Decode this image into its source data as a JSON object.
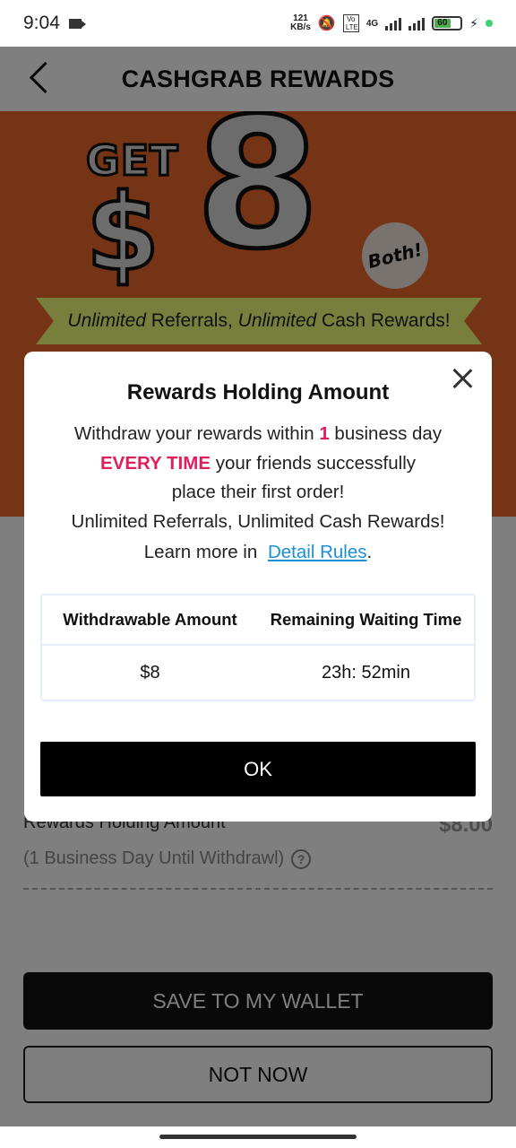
{
  "status_bar": {
    "time": "9:04",
    "net_speed_value": "121",
    "net_speed_unit": "KB/s",
    "network_type": "4G",
    "volte": "Vo LTE",
    "battery": "60"
  },
  "header": {
    "title": "CASHGRAB REWARDS"
  },
  "banner": {
    "get": "GET",
    "dollar": "$",
    "amount": "8",
    "both": "Both!",
    "ribbon_em1": "Unlimited",
    "ribbon_t1": " Referrals, ",
    "ribbon_em2": "Unlimited",
    "ribbon_t2": " Cash Rewards!"
  },
  "sheet": {
    "holding_label": "Rewards Holding Amount",
    "holding_value": "$8.00",
    "holding_sub": "(1 Business Day Until Withdrawl)",
    "help": "?",
    "save_button": "SAVE TO MY WALLET",
    "not_now_button": "NOT NOW"
  },
  "modal": {
    "title": "Rewards Holding Amount",
    "line1_a": "Withdraw your rewards within ",
    "line1_num": "1",
    "line1_b": " business day",
    "line2_accent": "EVERY TIME",
    "line2_b": " your friends successfully",
    "line3": "place their first order!",
    "line4": "Unlimited Referrals, Unlimited Cash Rewards!",
    "learn_prefix": "Learn more in ",
    "learn_link": "Detail Rules",
    "learn_suffix": ".",
    "table": {
      "headers": [
        "Withdrawable Amount",
        "Remaining Waiting Time"
      ],
      "row": [
        "$8",
        "23h: 52min"
      ]
    },
    "ok_button": "OK"
  },
  "colors": {
    "banner": "#e8692b",
    "ribbon": "#f1ff7a",
    "accent": "#e01e5a",
    "link": "#1a8fd6",
    "button": "#000000"
  }
}
